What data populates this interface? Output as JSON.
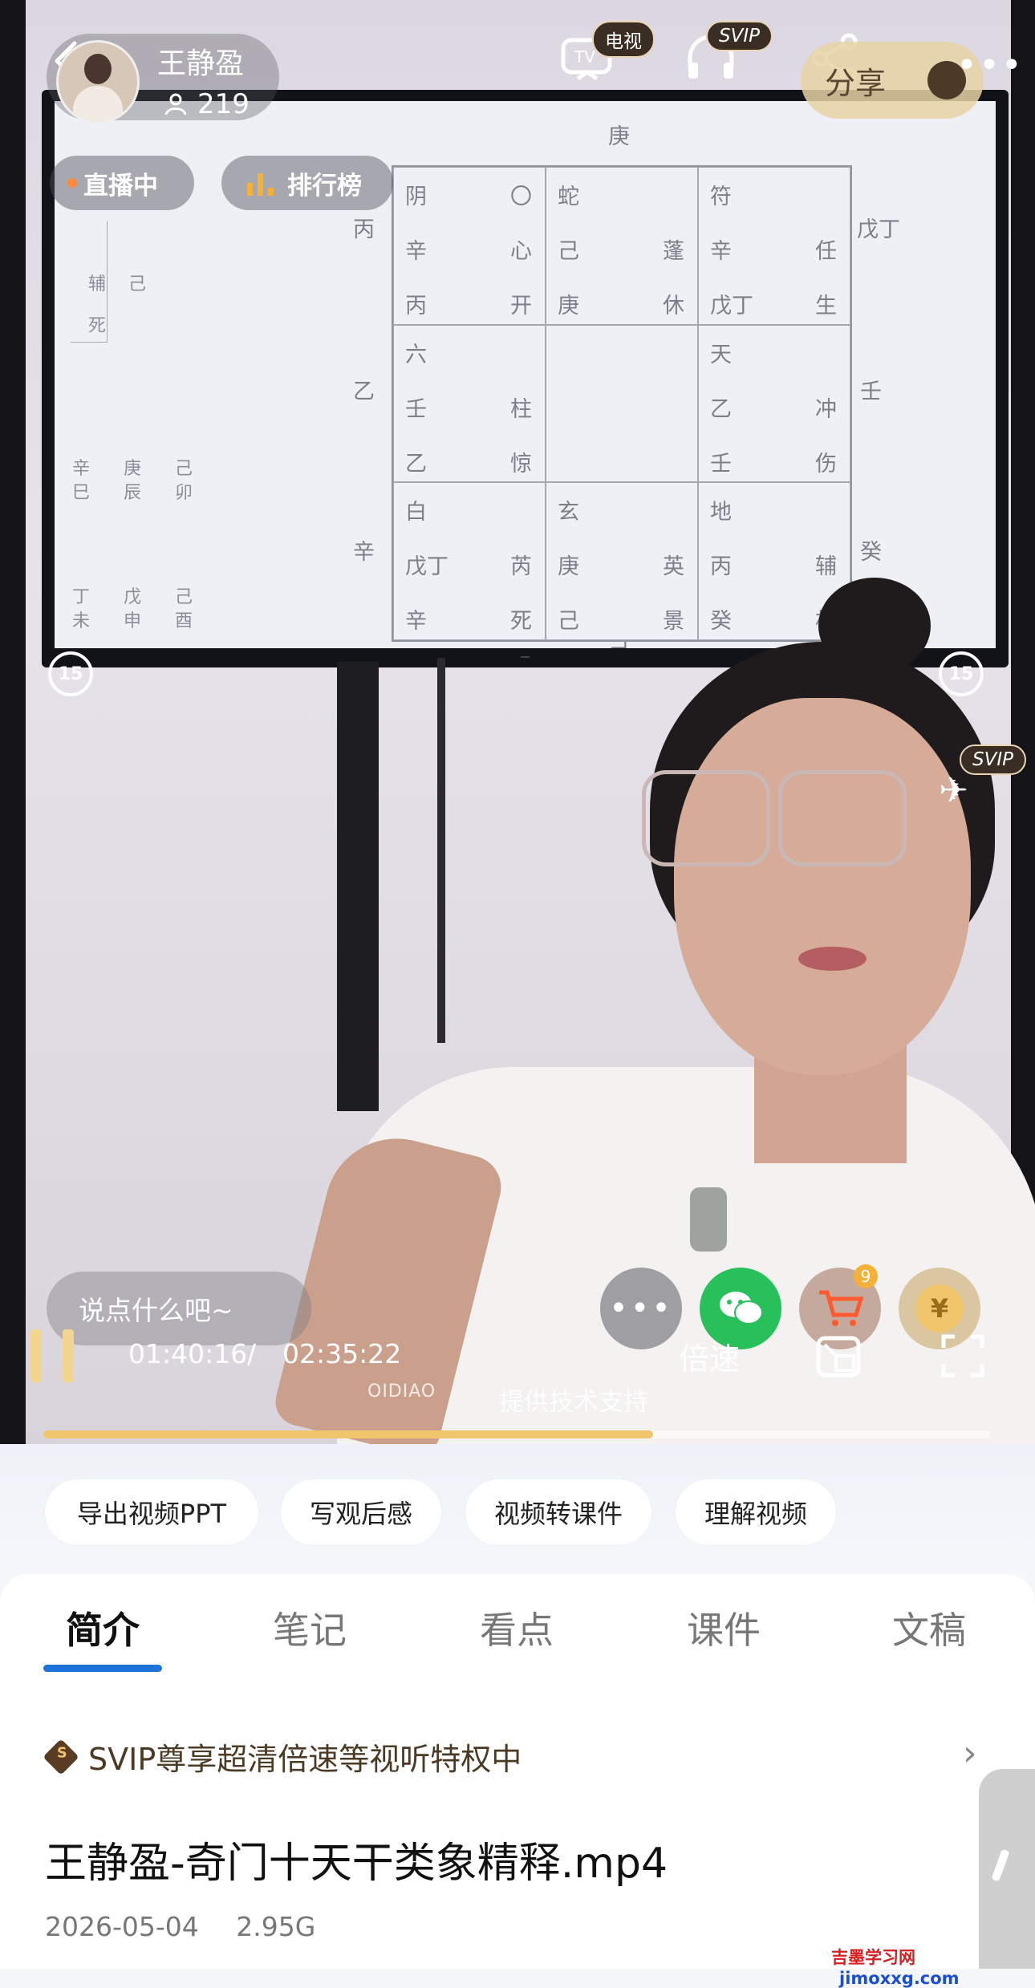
{
  "streamer": {
    "name": "王静盈",
    "viewers": "219"
  },
  "live": {
    "status": "直播中",
    "ranking": "排行榜"
  },
  "top_bar": {
    "tv_badge": "电视",
    "svip_badge": "SVIP",
    "share_label": "分享"
  },
  "side": {
    "svip_badge": "SVIP",
    "rewind_label": "15",
    "forward_label": "15"
  },
  "board": {
    "cells": [
      {
        "tl": "阴",
        "tr": "〇",
        "ml": "辛",
        "mr": "心",
        "bl": "丙",
        "br": "开"
      },
      {
        "tl": "蛇",
        "tr": "",
        "ml": "己",
        "mr": "蓬",
        "bl": "庚",
        "br": "休"
      },
      {
        "tl": "符",
        "tr": "",
        "ml": "辛",
        "mr": "任",
        "bl": "戊丁",
        "br": "生"
      },
      {
        "tl": "六",
        "tr": "",
        "ml": "壬",
        "mr": "柱",
        "bl": "乙",
        "br": "惊"
      },
      {
        "tl": "",
        "tr": "",
        "ml": "",
        "mr": "",
        "bl": "",
        "br": ""
      },
      {
        "tl": "天",
        "tr": "",
        "ml": "乙",
        "mr": "冲",
        "bl": "壬",
        "br": "伤"
      },
      {
        "tl": "白",
        "tr": "",
        "ml": "戊丁",
        "mr": "芮",
        "bl": "辛",
        "br": "死"
      },
      {
        "tl": "玄",
        "tr": "",
        "ml": "庚",
        "mr": "英",
        "bl": "己",
        "br": "景"
      },
      {
        "tl": "地",
        "tr": "",
        "ml": "丙",
        "mr": "辅",
        "bl": "癸",
        "br": "杜"
      }
    ],
    "outer": {
      "top": "庚",
      "left1": "丙",
      "left2": "乙",
      "left3": "辛",
      "right1": "戊丁",
      "right2": "壬",
      "right3": "癸",
      "bottom": "己"
    },
    "mini": {
      "a": "辅",
      "b": "己",
      "c": "死"
    },
    "pillars": [
      "辛",
      "庚",
      "己",
      "巳",
      "辰",
      "卯",
      "丁",
      "戊",
      "己",
      "未",
      "申",
      "酉"
    ]
  },
  "player": {
    "comment_placeholder": "说点什么吧~",
    "current_time": "01:40:16",
    "separator": "/",
    "duration": "02:35:22",
    "speed_label": "倍速",
    "tech_support": "提供技术支持",
    "tech_logo": "OIDIAO",
    "cart_count": "9",
    "coin_symbol": "¥",
    "progress": 0.644
  },
  "actions": [
    "导出视频PPT",
    "写观后感",
    "视频转课件",
    "理解视频"
  ],
  "tabs": [
    "简介",
    "笔记",
    "看点",
    "课件",
    "文稿"
  ],
  "svip_promo": {
    "icon_letter": "S",
    "text": "SVIP尊享超清倍速等视听特权中"
  },
  "file": {
    "title": "王静盈-奇门十天干类象精释.mp4",
    "date": "2026-05-04",
    "size": "2.95G"
  },
  "watermark": {
    "cn": "吉墨学习网",
    "en": "jimoxxg.com"
  },
  "colors": {
    "accent_blue": "#1e73d8",
    "progress_gold": "#f0c56b",
    "svip_brown": "#4b3a24"
  }
}
